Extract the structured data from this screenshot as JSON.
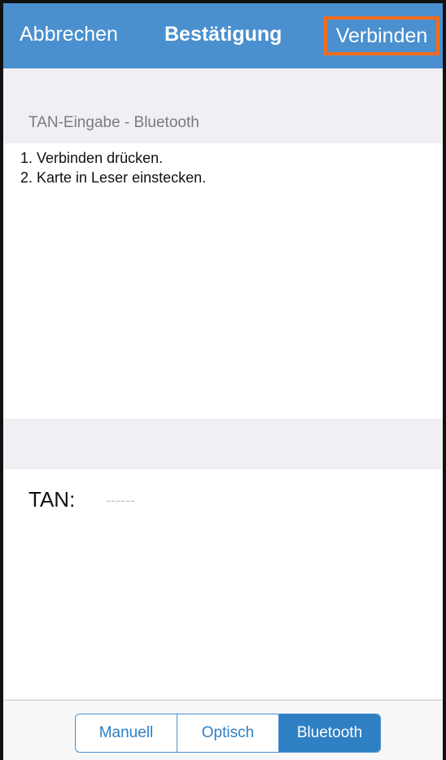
{
  "navbar": {
    "cancel_label": "Abbrechen",
    "title": "Bestätigung",
    "connect_label": "Verbinden",
    "background_color": "#4a90cf",
    "highlight_color": "#f26b1d"
  },
  "section": {
    "header": "TAN-Eingabe - Bluetooth",
    "instructions": [
      "1. Verbinden drücken.",
      "2. Karte in Leser einstecken."
    ]
  },
  "tan": {
    "label": "TAN:",
    "value": "",
    "placeholder": "------"
  },
  "segments": {
    "items": [
      {
        "label": "Manuell",
        "active": false
      },
      {
        "label": "Optisch",
        "active": false
      },
      {
        "label": "Bluetooth",
        "active": true
      }
    ],
    "accent_color": "#2f7fc4"
  }
}
